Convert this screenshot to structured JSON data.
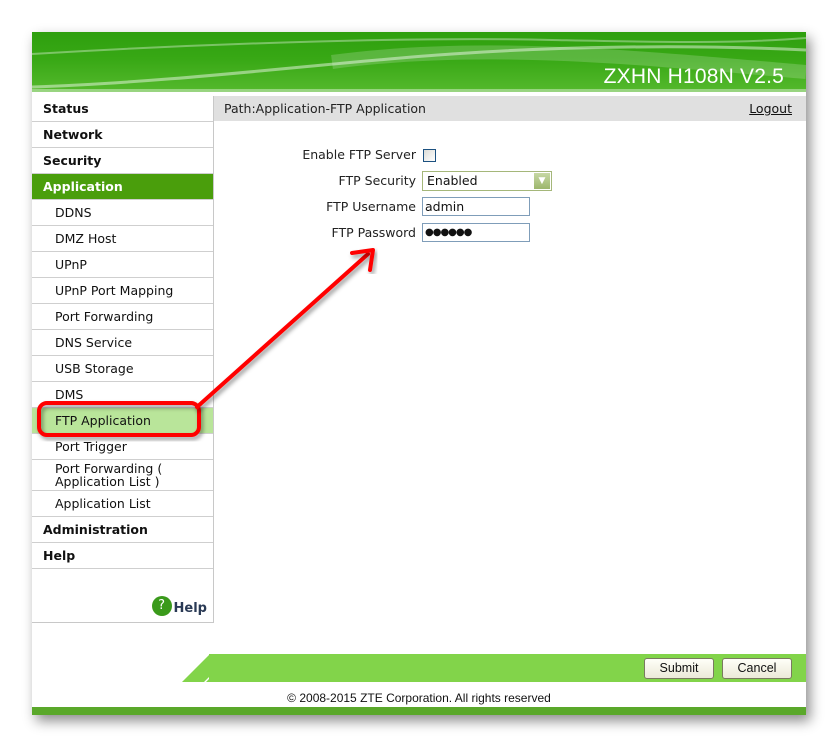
{
  "header": {
    "product_name": "ZXHN H108N V2.5"
  },
  "sidebar": {
    "items": [
      {
        "label": "Status",
        "level": "top"
      },
      {
        "label": "Network",
        "level": "top"
      },
      {
        "label": "Security",
        "level": "top"
      },
      {
        "label": "Application",
        "level": "top",
        "active": true
      },
      {
        "label": "DDNS",
        "level": "sub"
      },
      {
        "label": "DMZ Host",
        "level": "sub"
      },
      {
        "label": "UPnP",
        "level": "sub"
      },
      {
        "label": "UPnP Port Mapping",
        "level": "sub"
      },
      {
        "label": "Port Forwarding",
        "level": "sub"
      },
      {
        "label": "DNS Service",
        "level": "sub"
      },
      {
        "label": "USB Storage",
        "level": "sub"
      },
      {
        "label": "DMS",
        "level": "sub"
      },
      {
        "label": "FTP Application",
        "level": "sub",
        "active": true
      },
      {
        "label": "Port Trigger",
        "level": "sub"
      },
      {
        "label": "Port Forwarding ( Application List )",
        "line1": "Port Forwarding (",
        "line2": "Application List )",
        "level": "sub"
      },
      {
        "label": "Application List",
        "level": "sub"
      },
      {
        "label": "Administration",
        "level": "top"
      },
      {
        "label": "Help",
        "level": "top"
      }
    ],
    "help_icon": "question-circle-icon",
    "help_label": "Help"
  },
  "pathbar": {
    "path": "Path:Application-FTP Application",
    "logout": "Logout"
  },
  "form": {
    "enable_ftp_server": {
      "label": "Enable FTP Server",
      "checked": false
    },
    "ftp_security": {
      "label": "FTP Security",
      "value": "Enabled"
    },
    "ftp_username": {
      "label": "FTP Username",
      "value": "admin"
    },
    "ftp_password": {
      "label": "FTP Password",
      "value": "●●●●●●"
    }
  },
  "footer": {
    "submit": "Submit",
    "cancel": "Cancel",
    "copyright": "© 2008-2015 ZTE Corporation. All rights reserved"
  },
  "colors": {
    "brand_green": "#3aa815",
    "active_menu": "#4a9e0c",
    "active_submenu": "#b9e59a",
    "footer_green": "#82d44a",
    "annotation_red": "#ff0000"
  }
}
